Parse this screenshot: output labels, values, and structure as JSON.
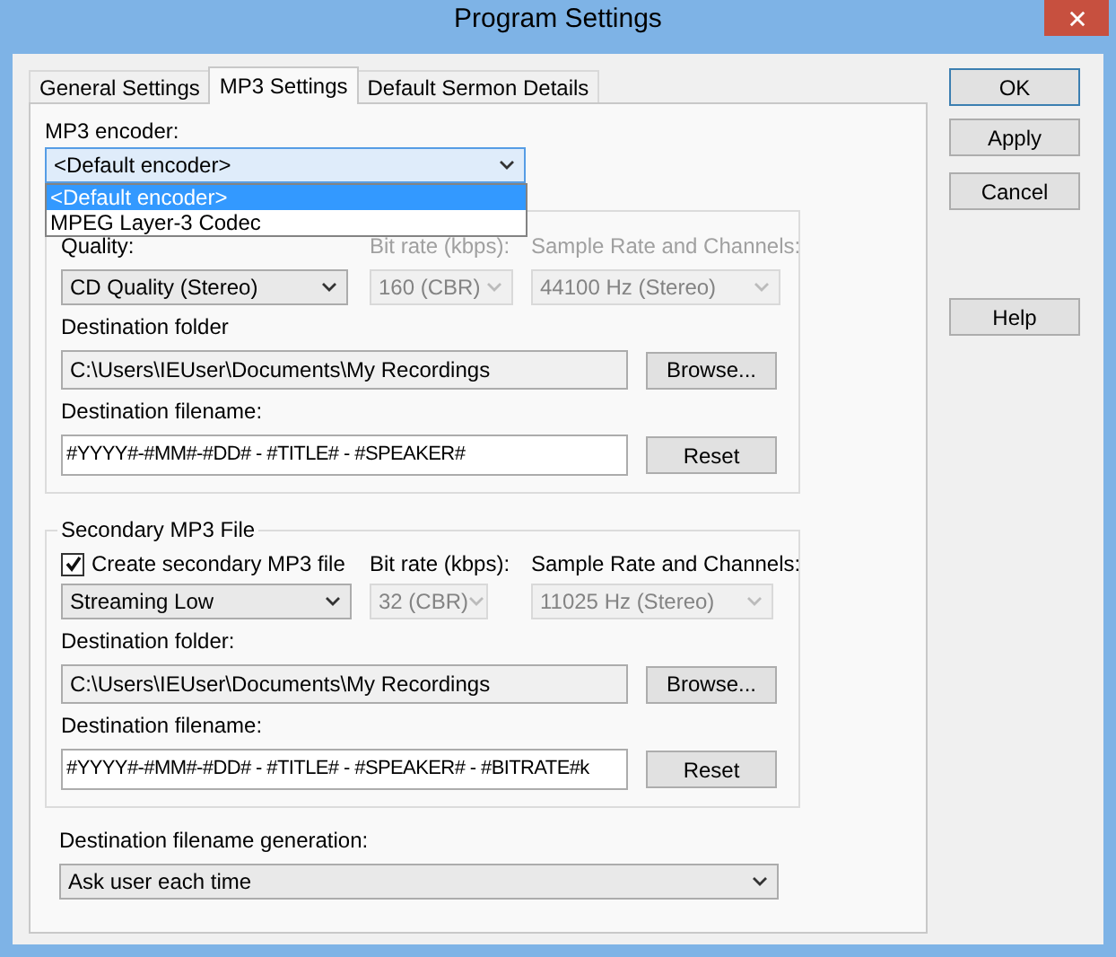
{
  "window": {
    "title": "Program Settings"
  },
  "tabs": [
    {
      "label": "General Settings",
      "selected": false
    },
    {
      "label": "MP3 Settings",
      "selected": true
    },
    {
      "label": "Default Sermon Details",
      "selected": false
    }
  ],
  "encoder": {
    "label": "MP3 encoder:",
    "value": "<Default encoder>",
    "open": true,
    "options": [
      {
        "label": "<Default encoder>",
        "selected": true
      },
      {
        "label": "MPEG Layer-3 Codec",
        "selected": false
      }
    ]
  },
  "groups": [
    {
      "columns": [
        {
          "kind": "label",
          "label": "Quality:",
          "label_disabled": false,
          "value": "CD Quality (Stereo)",
          "disabled": false
        },
        {
          "kind": "label",
          "label": "Bit rate (kbps):",
          "label_disabled": true,
          "value": "160 (CBR)",
          "disabled": true
        },
        {
          "kind": "label",
          "label": "Sample Rate and Channels:",
          "label_disabled": true,
          "value": "44100 Hz (Stereo)",
          "disabled": true
        }
      ],
      "folder": {
        "label": "Destination folder",
        "value": "C:\\Users\\IEUser\\Documents\\My Recordings",
        "button": "Browse..."
      },
      "filename": {
        "label": "Destination filename:",
        "value": "#YYYY#-#MM#-#DD# - #TITLE# - #SPEAKER#",
        "button": "Reset"
      }
    },
    {
      "title": "Secondary MP3 File",
      "columns": [
        {
          "kind": "checkbox",
          "label": "Create secondary MP3 file",
          "checked": true,
          "value": "Streaming Low",
          "disabled": false
        },
        {
          "kind": "label",
          "label": "Bit rate (kbps):",
          "label_disabled": false,
          "value": "32 (CBR)",
          "disabled": true
        },
        {
          "kind": "label",
          "label": "Sample Rate and Channels:",
          "label_disabled": false,
          "value": "11025 Hz (Stereo)",
          "disabled": true
        }
      ],
      "folder": {
        "label": "Destination folder:",
        "value": "C:\\Users\\IEUser\\Documents\\My Recordings",
        "button": "Browse..."
      },
      "filename": {
        "label": "Destination filename:",
        "value": "#YYYY#-#MM#-#DD# - #TITLE# - #SPEAKER# - #BITRATE#k",
        "button": "Reset"
      }
    }
  ],
  "generation": {
    "label": "Destination filename generation:",
    "value": "Ask user each time"
  },
  "buttons": [
    {
      "label": "OK",
      "default": true
    },
    {
      "label": "Apply",
      "default": false
    },
    {
      "label": "Cancel",
      "default": false
    },
    {
      "label": "Help",
      "default": false
    }
  ]
}
